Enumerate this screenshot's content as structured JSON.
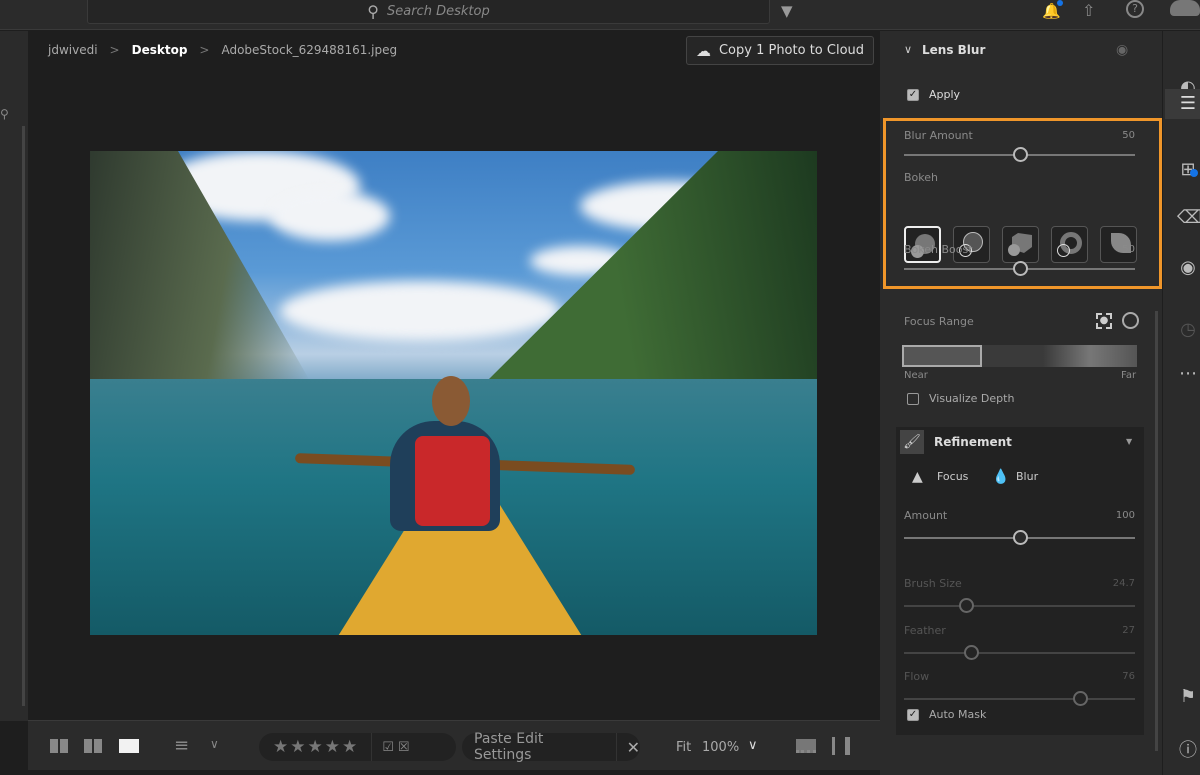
{
  "header": {
    "search_placeholder": "Search Desktop"
  },
  "breadcrumb": [
    "jdwivedi",
    "Desktop",
    "AdobeStock_629488161.jpeg"
  ],
  "copy_button": "Copy 1 Photo to Cloud",
  "bottom": {
    "paste": "Paste Edit Settings",
    "fit": "Fit",
    "zoom": "100%",
    "rating_stars": 5
  },
  "panel": {
    "title": "Lens Blur",
    "apply": "Apply",
    "apply_checked": true,
    "blur_amount": {
      "label": "Blur Amount",
      "value": 50,
      "max": 100
    },
    "bokeh_label": "Bokeh",
    "bokeh_selected": 0,
    "bokeh_boost": {
      "label": "Bokeh Boost",
      "value": 50,
      "max": 100
    },
    "focus_range": "Focus Range",
    "near": "Near",
    "far": "Far",
    "visualize": "Visualize Depth",
    "visualize_checked": false,
    "refinement": {
      "title": "Refinement",
      "focus": "Focus",
      "blur": "Blur",
      "amount": {
        "label": "Amount",
        "value": "100",
        "pos": 50
      },
      "brush": {
        "label": "Brush Size",
        "value": "24.7",
        "pos": 27
      },
      "feather": {
        "label": "Feather",
        "value": "27",
        "pos": 29
      },
      "flow": {
        "label": "Flow",
        "value": "76",
        "pos": 76
      },
      "automask": "Auto Mask",
      "automask_checked": true
    }
  },
  "colors": {
    "highlight": "#f0962a",
    "accent": "#1473e6"
  }
}
